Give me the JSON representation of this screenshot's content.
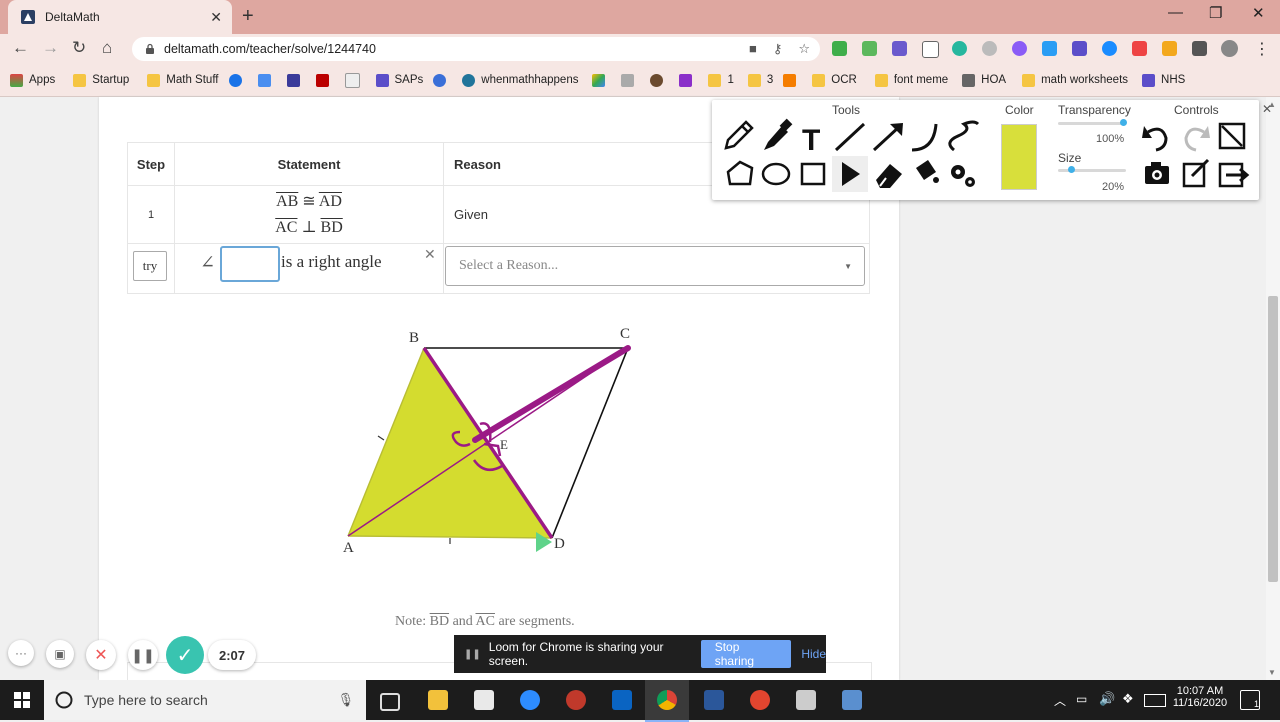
{
  "browser": {
    "tab_title": "DeltaMath",
    "url": "deltamath.com/teacher/solve/1244740",
    "bookmarks": [
      "Apps",
      "Startup",
      "Math Stuff",
      "SAPs",
      "whenmathhappens",
      "1",
      "3",
      "OCR",
      "font meme",
      "HOA",
      "math worksheets",
      "NHS"
    ]
  },
  "proof": {
    "headers": {
      "step": "Step",
      "statement": "Statement",
      "reason": "Reason"
    },
    "row1": {
      "step": "1",
      "stmt1_a": "AB",
      "stmt1_op": "≅",
      "stmt1_b": "AD",
      "stmt2_a": "AC",
      "stmt2_op": "⊥",
      "stmt2_b": "BD",
      "reason": "Given"
    },
    "row2": {
      "try_label": "try",
      "angle_symbol": "∠",
      "angle_suffix": "is a right angle",
      "reason_placeholder": "Select a Reason..."
    }
  },
  "diagram": {
    "labels": {
      "A": "A",
      "B": "B",
      "C": "C",
      "D": "D",
      "E": "E"
    },
    "note_prefix": "Note: ",
    "note_seg1": "BD",
    "note_and": " and ",
    "note_seg2": "AC",
    "note_suffix": " are segments."
  },
  "tools_panel": {
    "tools_title": "Tools",
    "color_title": "Color",
    "transparency_title": "Transparency",
    "transparency_value": "100%",
    "size_title": "Size",
    "size_value": "20%",
    "controls_title": "Controls",
    "accent_color": "#d8df3b"
  },
  "loom": {
    "timer": "2:07",
    "share_text": "Loom for Chrome is sharing your screen.",
    "stop_label": "Stop sharing",
    "hide_label": "Hide"
  },
  "taskbar": {
    "search_placeholder": "Type here to search",
    "time": "10:07 AM",
    "date": "11/16/2020"
  }
}
